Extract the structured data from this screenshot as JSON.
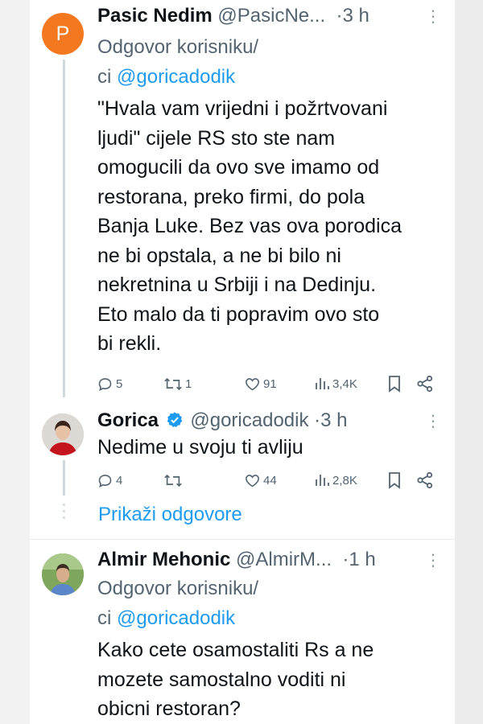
{
  "tweets": [
    {
      "name": "Pasic Nedim",
      "handle": "@PasicNe...",
      "time": "3 h",
      "avatar_letter": "P",
      "reply_prefix": "Odgovor korisniku/",
      "reply_prefix2": "ci",
      "reply_mention": "@goricadodik",
      "text": "\"Hvala vam vrijedni i požrtvovani\nljudi\" cijele RS sto ste nam\nomogucili da ovo sve imamo od\nrestorana, preko firmi, do pola\nBanja Luke. Bez vas ova porodica\nne bi opstala, a ne bi bilo ni\nnekretnina u Srbiji i na Dedinju.\nEto malo da ti popravim ovo sto\nbi rekli.",
      "stats": {
        "replies": "5",
        "retweets": "1",
        "likes": "91",
        "views": "3,4K"
      }
    },
    {
      "name": "Gorica",
      "handle": "@goricadodik",
      "time": "3 h",
      "text": "Nedime u svoju ti avliju",
      "stats": {
        "replies": "4",
        "retweets": "",
        "likes": "44",
        "views": "2,8K"
      }
    },
    {
      "name": "Almir Mehonic",
      "handle": "@AlmirM...",
      "time": "1 h",
      "reply_prefix": "Odgovor korisniku/",
      "reply_prefix2": "ci",
      "reply_mention": "@goricadodik",
      "text": "Kako cete osamostaliti Rs a ne\nmozete samostalno voditi ni\nobicni restoran?"
    }
  ],
  "show_replies_label": "Prikaži odgovore",
  "icons": [
    "reply-icon",
    "retweet-icon",
    "like-icon",
    "views-icon",
    "bookmark-icon",
    "share-icon",
    "verified-badge-icon",
    "more-icon"
  ],
  "colors": {
    "accent": "#1d9bf0",
    "text": "#0f1419",
    "muted": "#536471",
    "avatar_p": "#f4781f",
    "verified": "#1d9bf0"
  }
}
